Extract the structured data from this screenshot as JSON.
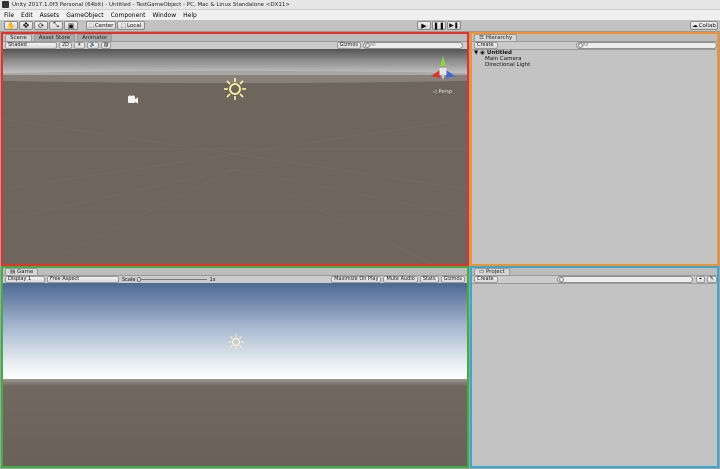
{
  "window": {
    "title": "Unity 2017.1.0f3 Personal (64bit) - Untitled - TestGameObject - PC, Mac & Linux Standalone <DX11>"
  },
  "menu": [
    "File",
    "Edit",
    "Assets",
    "GameObject",
    "Component",
    "Window",
    "Help"
  ],
  "toolbar": {
    "tools": [
      "hand-icon",
      "move-icon",
      "rotate-icon",
      "scale-icon",
      "rect-icon"
    ],
    "pivot_label": "Center",
    "space_label": "Local",
    "play_controls": [
      "play-icon",
      "pause-icon",
      "step-icon"
    ],
    "collab_label": "Collab"
  },
  "scene": {
    "tabs": [
      "Scene",
      "Asset Store",
      "Animator"
    ],
    "shading": "Shaded",
    "mode_2d": "2D",
    "gizmos": "Gizmos",
    "search_placeholder": "All",
    "persp_label": "Persp",
    "sky_top": "#5f5f5f",
    "ground": "#6e655d"
  },
  "hierarchy": {
    "tab": "Hierarchy",
    "create": "Create",
    "search_placeholder": "All",
    "scene_name": "Untitled",
    "items": [
      "Main Camera",
      "Directional Light"
    ]
  },
  "game": {
    "tab": "Game",
    "display": "Display 1",
    "aspect": "Free Aspect",
    "scale_label": "Scale",
    "scale_value": "1x",
    "maximize": "Maximize On Play",
    "mute": "Mute Audio",
    "stats": "Stats",
    "gizmos": "Gizmos"
  },
  "project": {
    "tab": "Project",
    "create": "Create"
  },
  "highlight_colors": {
    "scene": "#e8302a",
    "hierarchy": "#f39230",
    "game": "#3fae45",
    "project": "#3aa8cc"
  }
}
